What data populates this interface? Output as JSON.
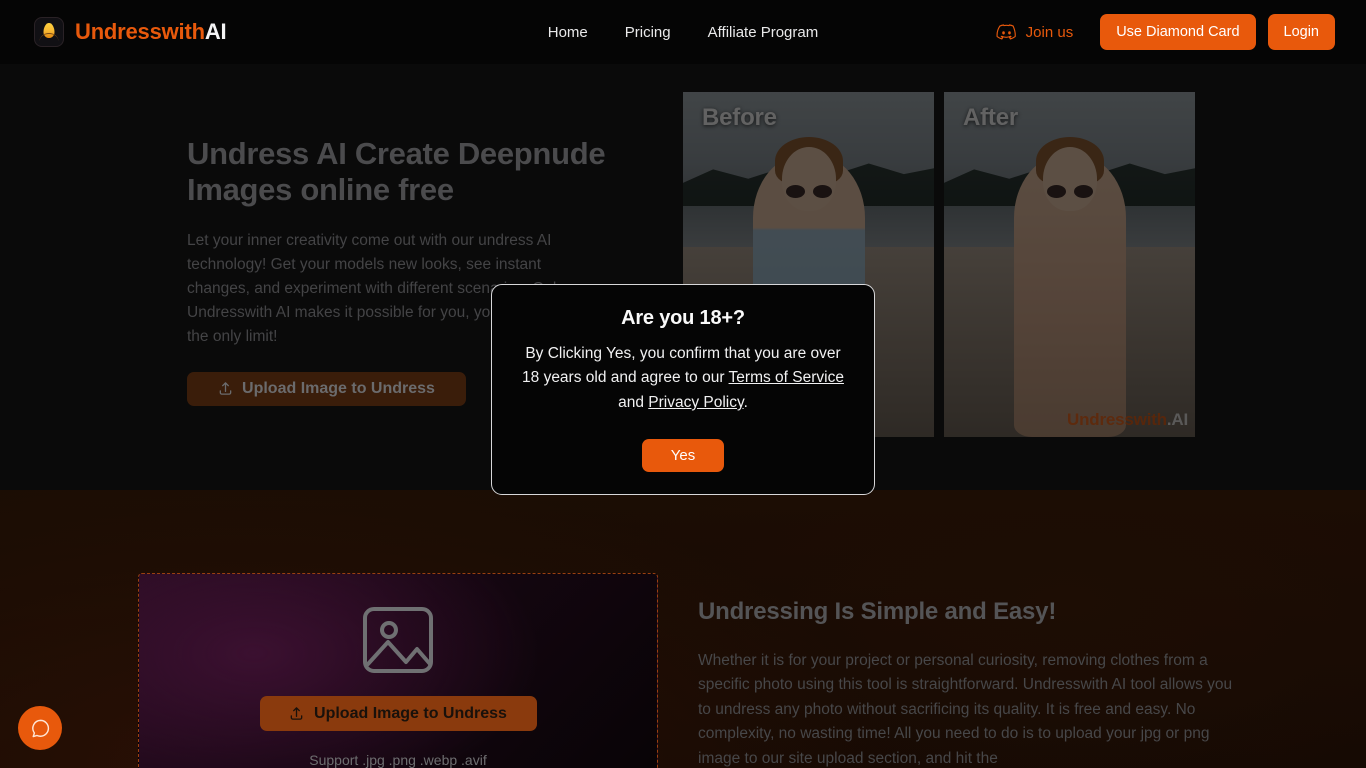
{
  "header": {
    "brand": {
      "part1": "Undresswith",
      "part2": "AI",
      "icon": "flame-logo-icon"
    },
    "nav": [
      {
        "label": "Home"
      },
      {
        "label": "Pricing"
      },
      {
        "label": "Affiliate Program"
      }
    ],
    "join": {
      "label": "Join us",
      "icon": "discord-icon",
      "color": "#e8590c"
    },
    "diamond_button": "Use Diamond Card",
    "login_button": "Login"
  },
  "hero": {
    "title": "Undress AI Create Deepnude Images online free",
    "subtitle": "Let your inner creativity come out with our undress AI technology! Get your models new looks, see instant changes, and experiment with different scenarios. Only Undresswith AI makes it possible for you, your imagination is the only limit!",
    "cta": "Upload Image to Undress",
    "cta_icon": "upload-icon",
    "before_label": "Before",
    "after_label": "After",
    "watermark_part1": "Undresswith",
    "watermark_part2": ".AI"
  },
  "dropzone": {
    "icon": "image-placeholder-icon",
    "cta": "Upload Image to Undress",
    "cta_icon": "upload-icon",
    "support": "Support .jpg .png .webp .avif"
  },
  "info": {
    "title": "Undressing Is Simple and Easy!",
    "body": "Whether it is for your project or personal curiosity, removing clothes from a specific photo using this tool is straightforward. Undresswith AI tool allows you to undress any photo without sacrificing its quality. It is free and easy. No complexity, no wasting time! All you need to do is to upload your jpg or png image to our site upload section, and hit the"
  },
  "chat": {
    "icon": "chat-bubble-icon"
  },
  "modal": {
    "title": "Are you 18+?",
    "text_before": "By Clicking Yes, you confirm that you are over 18 years old and agree to our ",
    "terms_link": "Terms of Service",
    "text_middle": " and ",
    "privacy_link": "Privacy Policy",
    "text_after": ".",
    "yes_button": "Yes"
  },
  "colors": {
    "accent": "#e8590c",
    "page_bg": "#0a0a0a",
    "lower_bg": "#1b0d04"
  }
}
